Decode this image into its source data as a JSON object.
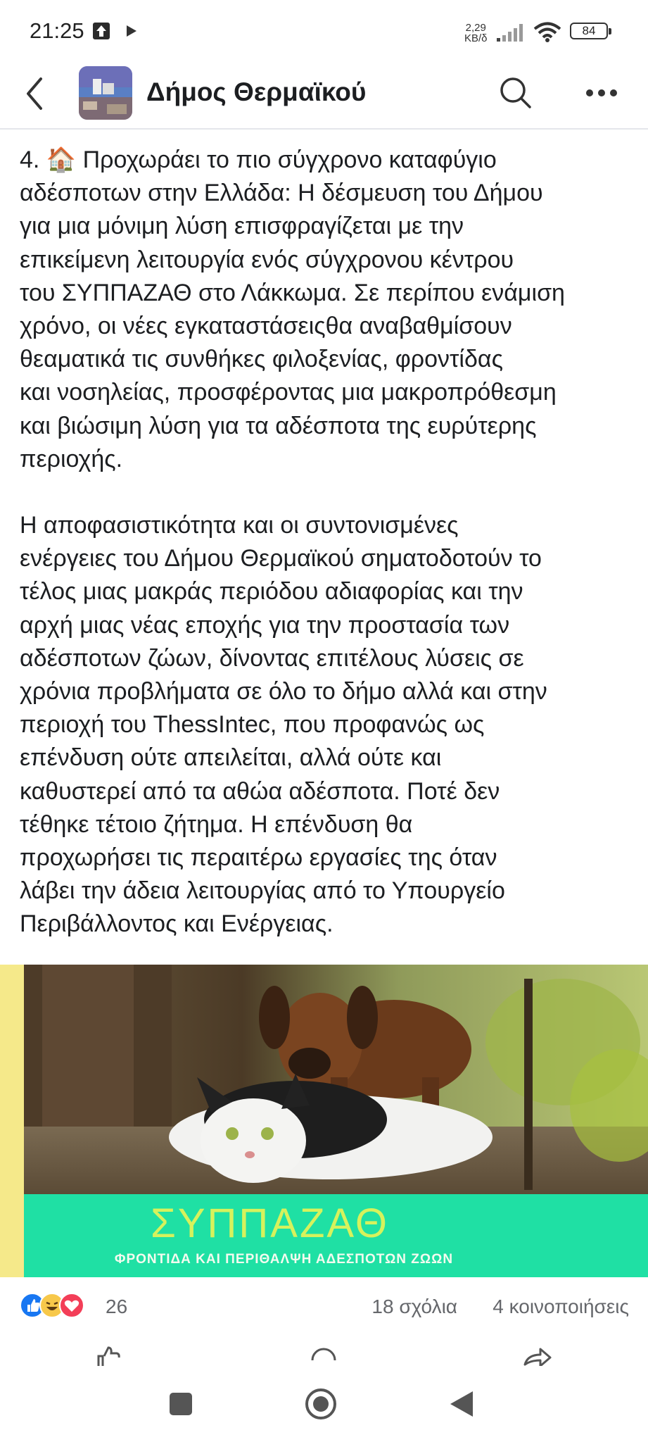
{
  "status_bar": {
    "time": "21:25",
    "net_speed_value": "2,29",
    "net_speed_unit": "KB/δ",
    "battery": "84"
  },
  "header": {
    "page_name": "Δήμος Θερμαϊκού"
  },
  "post": {
    "paragraphs": [
      "4. 🏠 Προχωράει το πιο σύγχρονο καταφύγιο\nαδέσποτων στην Ελλάδα: Η δέσμευση του Δήμου\nγια μια μόνιμη λύση επισφραγίζεται με την\nεπικείμενη λειτουργία ενός σύγχρονου κέντρου\nτου ΣΥΠΠΑΖΑΘ στο Λάκκωμα. Σε περίπου ενάμιση\nχρόνο, οι νέες εγκαταστάσειςθα αναβαθμίσουν\nθεαματικά τις συνθήκες φιλοξενίας, φροντίδας\nκαι νοσηλείας, προσφέροντας μια μακροπρόθεσμη\nκαι βιώσιμη λύση για τα αδέσποτα της ευρύτερης\nπεριοχής.",
      "Η αποφασιστικότητα και οι συντονισμένες\nενέργειες του Δήμου Θερμαϊκού σηματοδοτούν το\nτέλος μιας μακράς περιόδου αδιαφορίας και την\nαρχή μιας νέας εποχής για την προστασία των\nαδέσποτων ζώων, δίνοντας επιτέλους λύσεις σε\nχρόνια προβλήματα σε όλο το δήμο αλλά και στην\nπεριοχή του ThessIntec, που προφανώς ως\nεπένδυση ούτε απειλείται, αλλά ούτε και\nκαθυστερεί από τα αθώα αδέσποτα. Ποτέ δεν\nτέθηκε τέτοιο ζήτημα. Η επένδυση θα\nπροχωρήσει τις περαιτέρω εργασίες της όταν\nλάβει την άδεια λειτουργίας από το Υπουργείο\nΠεριβάλλοντος και Ενέργειας."
    ],
    "image_banner": {
      "title": "ΣΥΠΠΑΖΑΘ",
      "subtitle": "ΦΡΟΝΤΙΔΑ ΚΑΙ ΠΕΡΙΘΑΛΨΗ ΑΔΕΣΠΟΤΩΝ ΖΩΩΝ"
    },
    "reactions_count": "26",
    "comments": "18 σχόλια",
    "shares": "4 κοινοποιήσεις"
  },
  "colors": {
    "banner_band": "#1fe0a4",
    "banner_title": "#d6f25c",
    "like_blue": "#1877f2",
    "haha_yellow": "#f7c84a",
    "love_red": "#f33e58"
  },
  "icons": [
    "upload-icon",
    "play-icon",
    "signal-icon",
    "wifi-icon",
    "back-icon",
    "search-icon",
    "more-icon",
    "like-icon",
    "comment-icon",
    "share-icon",
    "square-icon",
    "home-icon",
    "back-triangle-icon"
  ]
}
